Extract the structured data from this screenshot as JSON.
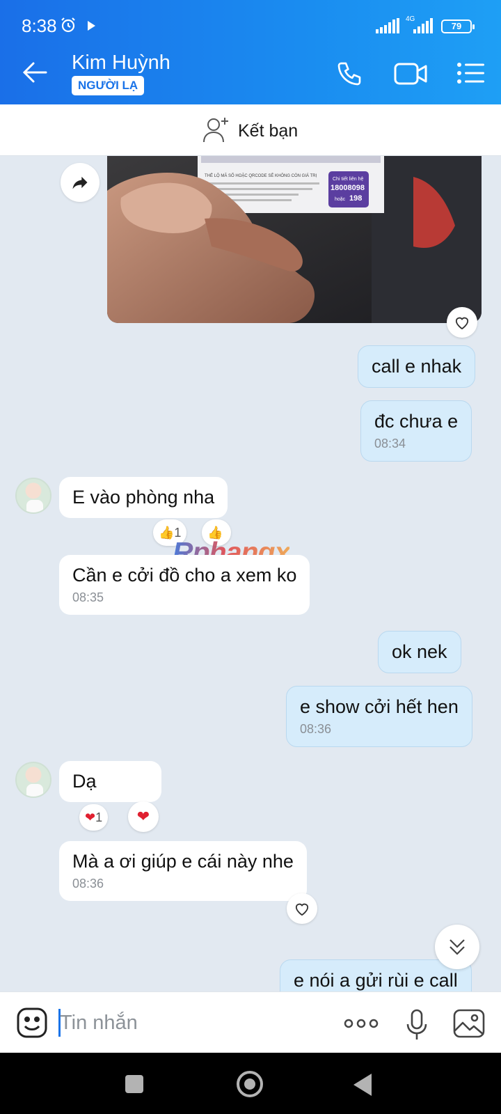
{
  "status_bar": {
    "time": "8:38",
    "network": "4G",
    "battery": "79"
  },
  "header": {
    "contact_name": "Kim Huỳnh",
    "badge": "NGƯỜI LẠ"
  },
  "friend_bar": {
    "label": "Kết bạn"
  },
  "watermark": "Rphangx",
  "messages": {
    "m1": {
      "text": "call e nhak"
    },
    "m2": {
      "text": "đc chưa e",
      "time": "08:34"
    },
    "m3": {
      "text": "E vào phòng nha",
      "reaction_count": "1"
    },
    "m4": {
      "text": "Cần e cởi đồ cho a xem ko",
      "time": "08:35"
    },
    "m5": {
      "text": "ok nek"
    },
    "m6": {
      "text": "e show cởi hết hen",
      "time": "08:36"
    },
    "m7": {
      "text": "Dạ",
      "reaction_count": "1"
    },
    "m8": {
      "text": "Mà a ơi giúp e cái này nhe",
      "time": "08:36"
    },
    "m9": {
      "text": "e nói a gửi rùi e call"
    }
  },
  "photo_receipt": {
    "line1": "THẺ LỘ MÃ SỐ HOẶC QRCODE SẼ KHÔNG CÒN GIÁ TRỊ",
    "hotline_label": "Chi tiết liên hệ",
    "hotline": "18008098",
    "alt_label": "hoặc",
    "alt": "198"
  },
  "input": {
    "placeholder": "Tin nhắn"
  },
  "colors": {
    "header": "#1a80ec",
    "me_bubble": "#d6ecfb",
    "them_bubble": "#ffffff",
    "background": "#e2e9f1"
  }
}
